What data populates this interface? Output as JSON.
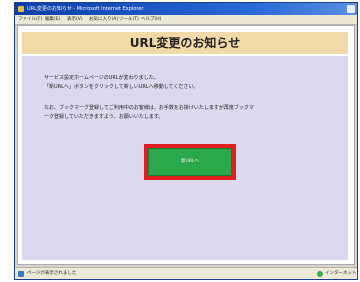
{
  "window": {
    "title": "URL変更のお知らせ - Microsoft Internet Explorer",
    "icon": "ie-icon"
  },
  "menu": {
    "items": [
      "ファイル(F)",
      "編集(E)",
      "表示(V)",
      "お気に入り(A)",
      "ツール(T)",
      "ヘルプ(H)"
    ]
  },
  "page": {
    "banner_title": "URL変更のお知らせ",
    "paragraph1_line1": "サービス設定ホームページのURLが変わりました。",
    "paragraph1_line2": "「新URLへ」ボタンをクリックして新しいURLへ移動してください。",
    "paragraph2_line1": "なお、ブックマーク登録してご利用中のお客様は、お手数をお掛けいたしますが再度ブックマ",
    "paragraph2_line2": "ーク登録していただきますよう、お願いいたします。",
    "button_label": "新URLへ"
  },
  "status": {
    "left_text": "ページが表示されました",
    "zone_text": "インターネット"
  },
  "colors": {
    "banner": "#f2d9a8",
    "panel": "#dcd9ef",
    "button": "#2aa84a",
    "button_highlight": "#e02020"
  }
}
